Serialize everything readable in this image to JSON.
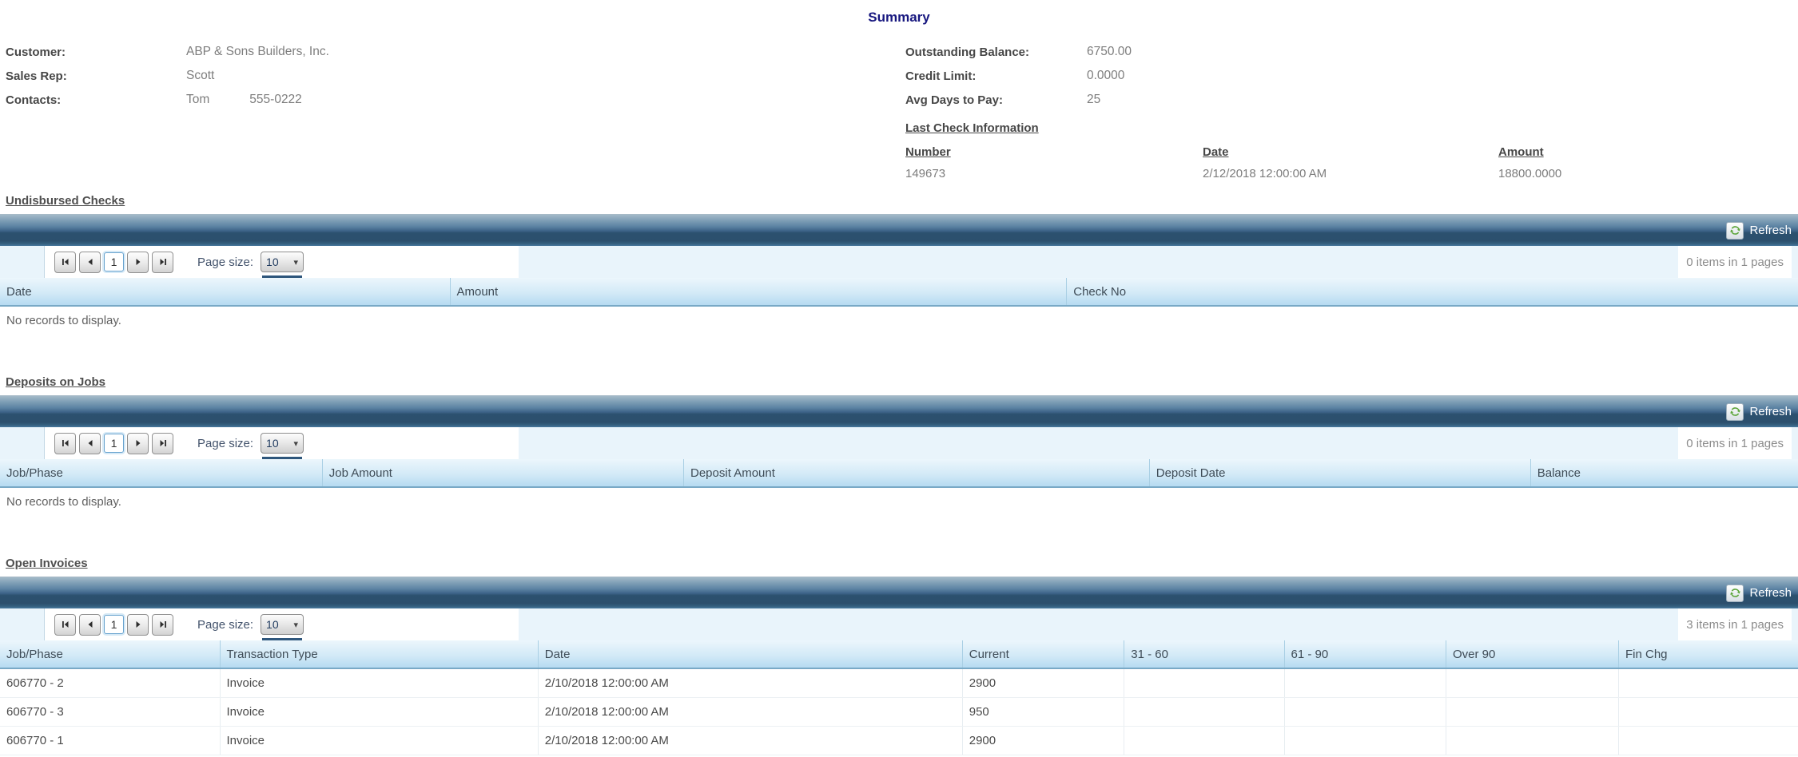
{
  "summary": {
    "title": "Summary",
    "customer": [
      {
        "label": "Customer:",
        "value": "ABP & Sons Builders, Inc."
      },
      {
        "label": "Sales Rep:",
        "value": "Scott"
      },
      {
        "label": "Contacts:",
        "value": "Tom",
        "extra": "555-0222"
      }
    ],
    "stats": [
      {
        "label": "Outstanding Balance:",
        "value": "6750.00"
      },
      {
        "label": "Credit Limit:",
        "value": "0.0000"
      },
      {
        "label": "Avg Days to Pay:",
        "value": "25"
      }
    ],
    "last_check": {
      "title": "Last Check Information",
      "columns": [
        "Number",
        "Date",
        "Amount"
      ],
      "values": [
        "149673",
        "2/12/2018 12:00:00 AM",
        "18800.0000"
      ]
    }
  },
  "pager": {
    "page_value": "1",
    "page_size_label": "Page size:",
    "page_size_value": "10"
  },
  "refresh_label": "Refresh",
  "grids": [
    {
      "title": "Undisbursed Checks",
      "columns": [
        "Date",
        "Amount",
        "Check No"
      ],
      "rows": [],
      "empty_text": "No records to display.",
      "items_text": "0 items in 1 pages"
    },
    {
      "title": "Deposits on Jobs",
      "columns": [
        "Job/Phase",
        "Job Amount",
        "Deposit Amount",
        "Deposit Date",
        "Balance"
      ],
      "rows": [],
      "empty_text": "No records to display.",
      "items_text": "0 items in 1 pages"
    },
    {
      "title": "Open Invoices",
      "columns": [
        "Job/Phase",
        "Transaction Type",
        "Date",
        "Current",
        "31 - 60",
        "61 - 90",
        "Over 90",
        "Fin Chg"
      ],
      "rows": [
        [
          "606770 - 2",
          "Invoice",
          "2/10/2018 12:00:00 AM",
          "2900",
          "",
          "",
          "",
          ""
        ],
        [
          "606770 - 3",
          "Invoice",
          "2/10/2018 12:00:00 AM",
          "950",
          "",
          "",
          "",
          ""
        ],
        [
          "606770 - 1",
          "Invoice",
          "2/10/2018 12:00:00 AM",
          "2900",
          "",
          "",
          "",
          ""
        ]
      ],
      "empty_text": "",
      "items_text": "3 items in 1 pages"
    }
  ],
  "colors": {
    "summary_title_navy": "#17177f",
    "bar_dark_blue": "#2c516f",
    "header_row_blue": "#b6dbf1",
    "refresh_icon_green": "#5ca53a"
  }
}
